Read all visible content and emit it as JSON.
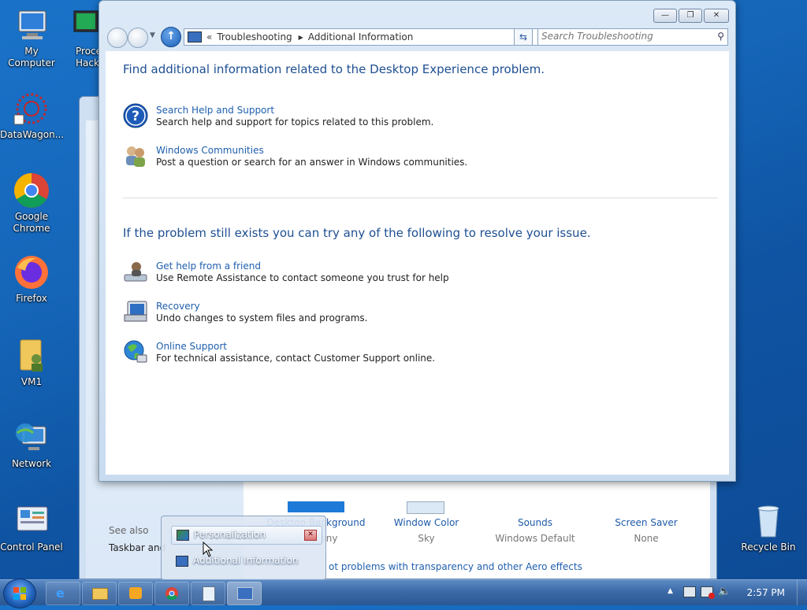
{
  "desktop": {
    "icons": [
      {
        "label": "My Computer"
      },
      {
        "label": "Proce\nHacke"
      },
      {
        "label": "DataWagon..."
      },
      {
        "label": "Google\nChrome"
      },
      {
        "label": "Firefox"
      },
      {
        "label": "VM1"
      },
      {
        "label": "Network"
      },
      {
        "label": "Control Panel"
      },
      {
        "label": "Recycle Bin"
      }
    ]
  },
  "background_window": {
    "items": [
      {
        "title": "Desktop Background",
        "subtitle": "Harmony"
      },
      {
        "title": "Window Color",
        "subtitle": "Sky"
      },
      {
        "title": "Sounds",
        "subtitle": "Windows Default"
      },
      {
        "title": "Screen Saver",
        "subtitle": "None"
      }
    ],
    "see_also": "See also",
    "taskbar_link": "Taskbar and",
    "aero_link": "ot problems with transparency and other Aero effects"
  },
  "window": {
    "breadcrumb_chevron": "«",
    "breadcrumb": [
      "Troubleshooting",
      "Additional Information"
    ],
    "search_placeholder": "Search Troubleshooting",
    "heading1": "Find additional information related to the Desktop Experience problem.",
    "heading2": "If the problem still exists you can try any of the following to resolve your issue.",
    "tasks1": [
      {
        "title": "Search Help and Support",
        "desc": "Search help and support for topics related to this problem.",
        "icon": "help-icon"
      },
      {
        "title": "Windows Communities",
        "desc": "Post a question or search for an answer in Windows communities.",
        "icon": "people-icon"
      }
    ],
    "tasks2": [
      {
        "title": "Get help from a friend",
        "desc": "Use Remote Assistance to contact someone you trust for help",
        "icon": "remote-assistance-icon"
      },
      {
        "title": "Recovery",
        "desc": "Undo changes to system files and programs.",
        "icon": "recovery-icon"
      },
      {
        "title": "Online Support",
        "desc": "For technical assistance, contact Customer Support online.",
        "icon": "globe-icon"
      }
    ]
  },
  "popup": {
    "items": [
      "Personalization",
      "Additional Information"
    ]
  },
  "taskbar": {
    "clock": "2:57 PM"
  }
}
